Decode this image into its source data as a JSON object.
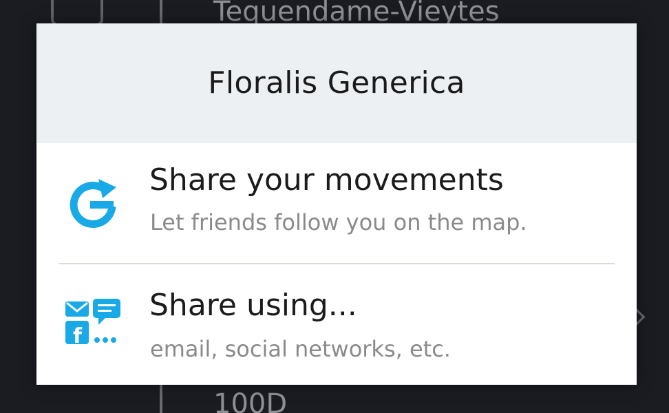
{
  "background": {
    "top_text": "Tequendame-Vieytes",
    "bottom_text": "100D"
  },
  "dialog": {
    "title": "Floralis Generica",
    "items": [
      {
        "label": "Share your movements",
        "sublabel": "Let friends follow you on the map.",
        "icon": "share-movements-icon"
      },
      {
        "label": "Share using...",
        "sublabel": "email, social networks, etc.",
        "icon": "share-using-icon"
      }
    ]
  },
  "colors": {
    "accent": "#19a9e6",
    "header_bg": "#edf0f3",
    "backdrop": "#1b1c22"
  }
}
